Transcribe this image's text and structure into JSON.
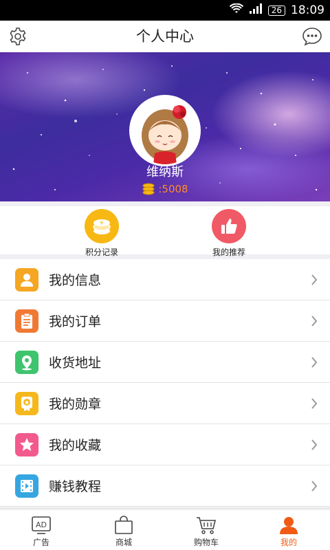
{
  "status_bar": {
    "battery": "26",
    "time": "18:09"
  },
  "header": {
    "title": "个人中心"
  },
  "profile": {
    "username": "维纳斯",
    "points": ":5008"
  },
  "quick_actions": [
    {
      "label": "积分记录",
      "icon": "coins-icon",
      "color": "#f7b814"
    },
    {
      "label": "我的推荐",
      "icon": "thumbs-up-icon",
      "color": "#f05a66"
    }
  ],
  "menu": [
    {
      "label": "我的信息",
      "icon": "user-icon",
      "color": "#f5a623"
    },
    {
      "label": "我的订单",
      "icon": "clipboard-icon",
      "color": "#f07a34"
    },
    {
      "label": "收货地址",
      "icon": "location-pin-icon",
      "color": "#3ec46d"
    },
    {
      "label": "我的勋章",
      "icon": "medal-icon",
      "color": "#f5b81c"
    },
    {
      "label": "我的收藏",
      "icon": "star-icon",
      "color": "#f25a8e"
    },
    {
      "label": "赚钱教程",
      "icon": "video-icon",
      "color": "#35a6e0"
    }
  ],
  "bottom_nav": [
    {
      "label": "广告",
      "icon": "ad-icon",
      "active": false
    },
    {
      "label": "商城",
      "icon": "shopping-bag-icon",
      "active": false
    },
    {
      "label": "购物车",
      "icon": "cart-icon",
      "active": false
    },
    {
      "label": "我的",
      "icon": "user-icon",
      "active": true
    }
  ],
  "colors": {
    "accent": "#f05a14",
    "header_bg": "#ffffff",
    "points": "#ff8a2a"
  }
}
